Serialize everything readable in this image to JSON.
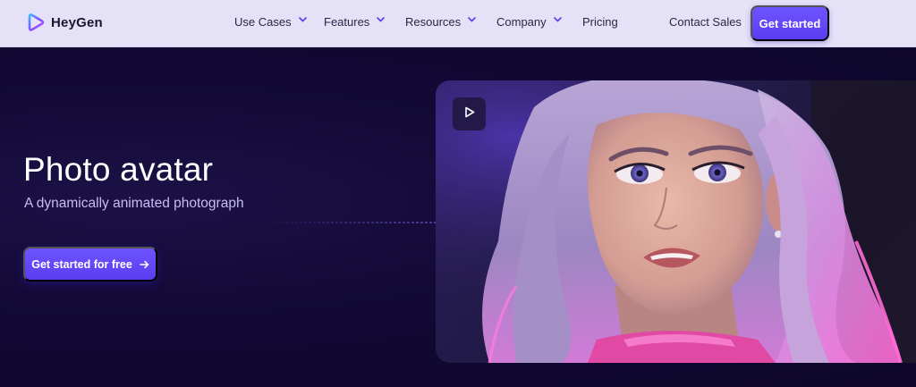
{
  "nav": {
    "brand": "HeyGen",
    "items": [
      {
        "label": "Use Cases",
        "has_dropdown": true
      },
      {
        "label": "Features",
        "has_dropdown": true
      },
      {
        "label": "Resources",
        "has_dropdown": true
      },
      {
        "label": "Company",
        "has_dropdown": true
      },
      {
        "label": "Pricing",
        "has_dropdown": false
      }
    ],
    "contact_label": "Contact Sales",
    "cta_label": "Get started"
  },
  "hero": {
    "title": "Photo avatar",
    "subtitle": "A dynamically animated photograph",
    "cta_label": "Get started for free",
    "cta_icon": "arrow-right-icon",
    "media": {
      "play_icon": "play-icon"
    }
  },
  "colors": {
    "accent": "#6243f7",
    "nav_bg": "#e5e1f7",
    "hero_bg": "#120935",
    "subtitle": "#c7bcf4"
  }
}
